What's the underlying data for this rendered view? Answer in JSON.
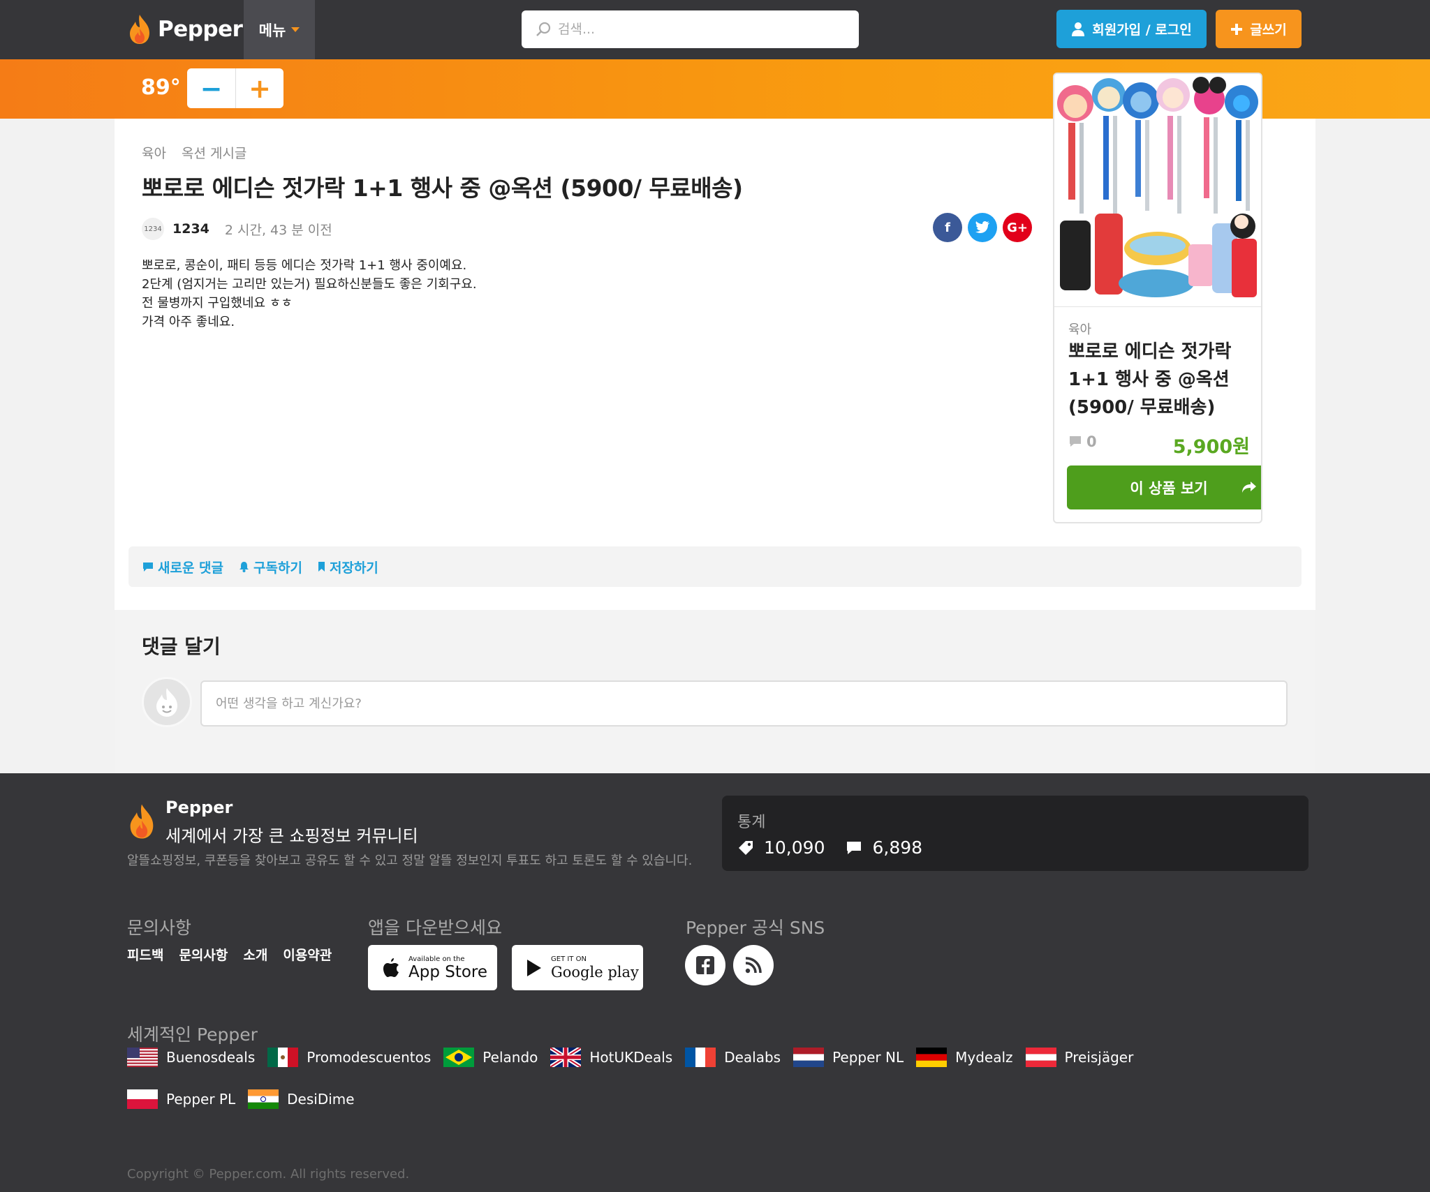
{
  "header": {
    "logo_text": "Pepper",
    "menu_label": "메뉴",
    "search_placeholder": "검색...",
    "login_label": "회원가입 / 로그인",
    "write_label": "글쓰기"
  },
  "vote": {
    "temperature": "89°",
    "minus": "−",
    "plus": "+"
  },
  "post": {
    "breadcrumbs": [
      "육아",
      "옥션 게시글"
    ],
    "title": "뽀로로 에디슨 젓가락 1+1 행사 중 @옥션 (5900/ 무료배송)",
    "avatar_text": "1234",
    "author": "1234",
    "time": "2 시간, 43 분 이전",
    "body_lines": [
      "뽀로로, 콩순이, 패티 등등 에디슨 젓가락 1+1 행사 중이예요.",
      "2단계 (엄지거는 고리만 있는거) 필요하신분들도 좋은 기회구요.",
      "전 물병까지 구입했네요 ㅎㅎ",
      "가격 아주 좋네요."
    ]
  },
  "share": {
    "facebook": "f",
    "twitter": "t",
    "google": "G+"
  },
  "deal": {
    "category": "육아",
    "title": "뽀로로 에디슨 젓가락 1+1 행사 중 @옥션 (5900/ 무료배송)",
    "comments": "0",
    "price": "5,900원",
    "button_label": "이 상품 보기"
  },
  "actions": {
    "new_comment": "새로운 댓글",
    "subscribe": "구독하기",
    "save": "저장하기"
  },
  "comment": {
    "title": "댓글 달기",
    "placeholder": "어떤 생각을 하고 계신가요?"
  },
  "footer": {
    "name": "Pepper",
    "tagline": "세계에서 가장 큰 쇼핑정보 커뮤니티",
    "description": "알뜰쇼핑정보, 쿠폰등을 찾아보고 공유도 할 수 있고 정말 알뜰 정보인지 투표도 하고 토론도 할 수 있습니다.",
    "stats_label": "통계",
    "deals_count": "10,090",
    "comments_count": "6,898",
    "contact_heading": "문의사항",
    "contact_links": [
      "피드백",
      "문의사항",
      "소개",
      "이용약관"
    ],
    "app_heading": "앱을 다운받으세요",
    "appstore_small": "Available on the",
    "appstore_big": "App Store",
    "googleplay_small": "GET IT ON",
    "googleplay_big": "Google play",
    "sns_heading": "Pepper 공식 SNS",
    "intl_heading": "세계적인 Pepper",
    "intl_sites": [
      "Buenosdeals",
      "Promodescuentos",
      "Pelando",
      "HotUKDeals",
      "Dealabs",
      "Pepper NL",
      "Mydealz",
      "Preisjäger",
      "Pepper PL",
      "DesiDime"
    ],
    "copyright": "Copyright © Pepper.com. All rights reserved."
  },
  "colors": {
    "header_bg": "#363639",
    "accent_orange": "#f7941d",
    "accent_blue": "#1ea0d9",
    "price_green": "#5aa821",
    "button_green": "#4e9e1c"
  }
}
